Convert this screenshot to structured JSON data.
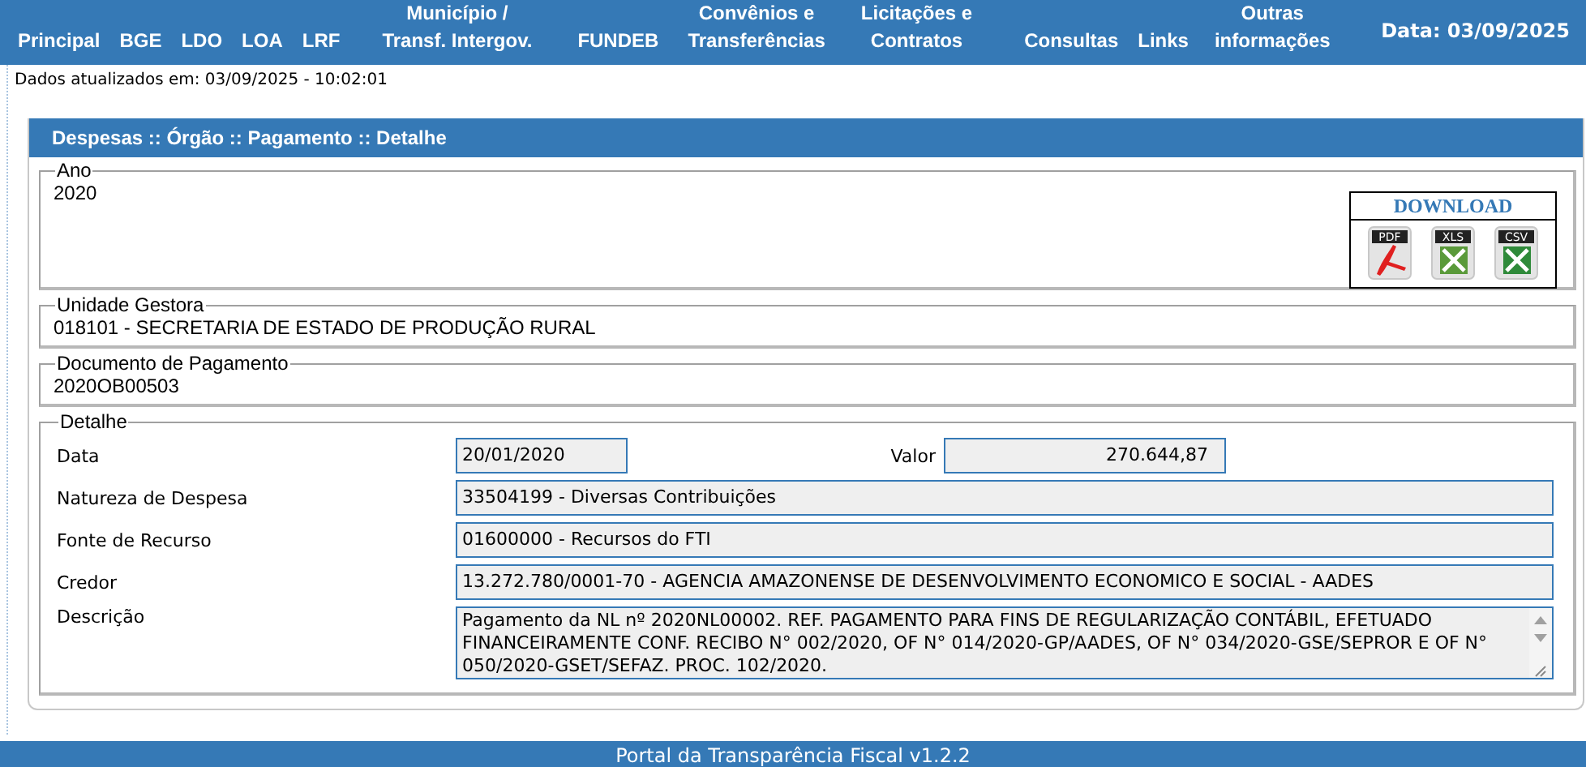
{
  "nav": {
    "items": [
      {
        "label": "Principal"
      },
      {
        "label": "BGE"
      },
      {
        "label": "LDO"
      },
      {
        "label": "LOA"
      },
      {
        "label": "LRF"
      },
      {
        "label": "Município /\nTransf. Intergov."
      },
      {
        "label": "FUNDEB"
      },
      {
        "label": "Convênios e\nTransferências"
      },
      {
        "label": "Licitações e\nContratos"
      },
      {
        "label": "Consultas"
      },
      {
        "label": "Links"
      },
      {
        "label": "Outras\ninformações"
      }
    ],
    "date": "Data: 03/09/2025"
  },
  "updated": "Dados atualizados em: 03/09/2025 - 10:02:01",
  "panel": {
    "title": "Despesas :: Órgão :: Pagamento :: Detalhe",
    "year": {
      "legend": "Ano",
      "value": "2020"
    },
    "download": {
      "title": "DOWNLOAD",
      "files": [
        {
          "label": "PDF",
          "kind": "pdf"
        },
        {
          "label": "XLS",
          "kind": "xls"
        },
        {
          "label": "CSV",
          "kind": "csv"
        }
      ]
    },
    "unit": {
      "legend": "Unidade Gestora",
      "value": "018101 - SECRETARIA DE ESTADO DE PRODUÇÃO RURAL"
    },
    "document": {
      "legend": "Documento de Pagamento",
      "value": "2020OB00503"
    },
    "detail": {
      "legend": "Detalhe",
      "date": {
        "label": "Data",
        "value": "20/01/2020"
      },
      "amount": {
        "label": "Valor",
        "value": "270.644,87"
      },
      "rows": [
        {
          "label": "Natureza de Despesa",
          "value": "33504199 - Diversas Contribuições"
        },
        {
          "label": "Fonte de Recurso",
          "value": "01600000 - Recursos do FTI"
        },
        {
          "label": "Credor",
          "value": "13.272.780/0001-70 - AGENCIA AMAZONENSE DE DESENVOLVIMENTO ECONOMICO E SOCIAL - AADES"
        }
      ],
      "description": {
        "label": "Descrição",
        "value": "Pagamento da NL nº 2020NL00002. REF. PAGAMENTO PARA FINS DE REGULARIZAÇÃO CONTÁBIL, EFETUADO FINANCEIRAMENTE CONF. RECIBO N° 002/2020, OF N° 014/2020-GP/AADES, OF N° 034/2020-GSE/SEPROR E OF N° 050/2020-GSET/SEFAZ. PROC. 102/2020."
      }
    }
  },
  "footer": "Portal da Transparência Fiscal v1.2.2"
}
